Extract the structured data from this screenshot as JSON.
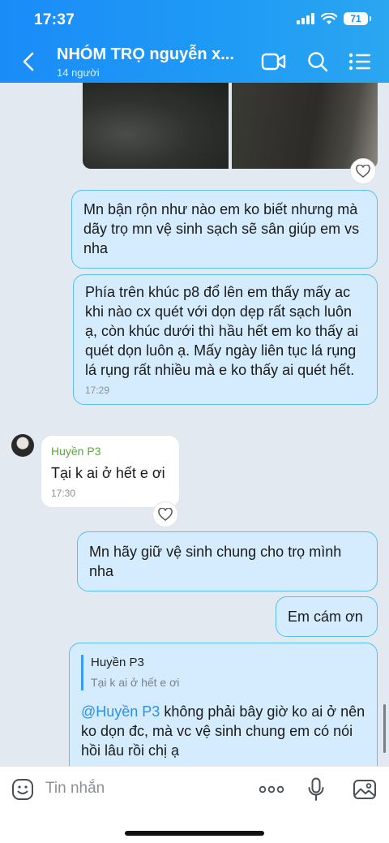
{
  "status_bar": {
    "time": "17:37",
    "battery": "71"
  },
  "header": {
    "title": "NHÓM TRỌ nguyễn x...",
    "subtitle": "14 người"
  },
  "messages": {
    "m1": {
      "text": "Mn bận rộn như nào em ko biết nhưng mà dãy trọ mn vệ sinh sạch sẽ sân giúp em vs nha"
    },
    "m2": {
      "text": "Phía trên khúc p8 đổ lên em thấy mấy ac khi nào cx quét với dọn dẹp rất sạch luôn ạ, còn khúc dưới thì hầu hết em ko thấy ai quét dọn luôn ạ. Mấy ngày liên tục lá rụng lá rụng rất nhiều mà e ko thấy ai quét hết.",
      "time": "17:29"
    },
    "m3": {
      "sender": "Huyền P3",
      "text": "Tại k ai ở hết e ơi",
      "time": "17:30"
    },
    "m4": {
      "text": "Mn hãy giữ vệ sinh chung cho trọ mình nha"
    },
    "m5": {
      "text": "Em cám ơn"
    },
    "m6": {
      "quote_name": "Huyền P3",
      "quote_text": "Tại k ai ở hết e ơi",
      "mention": "@Huyền P3",
      "text": " không phải bây giờ ko ai ở nên ko dọn đc, mà vc vệ sinh chung em có nói hồi lâu rồi chị ạ"
    }
  },
  "input": {
    "placeholder": "Tin nhắn"
  },
  "colors": {
    "header": "#1a8cf8",
    "out_bubble": "#d5ecfe",
    "out_border": "#58bdf0",
    "sender_name": "#5aa73a",
    "mention": "#2a8ff2"
  }
}
